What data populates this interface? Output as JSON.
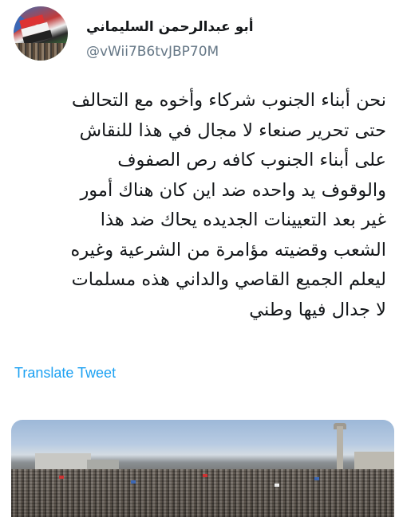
{
  "tweet": {
    "author": {
      "display_name": "أبو عبدالرحمن السليماني",
      "handle": "@vWii7B6tvJBP70M"
    },
    "text_lines": [
      "نحن أبناء الجنوب شركاء وأخوه مع التحالف",
      "حتى تحرير صنعاء لا مجال في هذا للنقاش",
      "على أبناء الجنوب كافه رص الصفوف",
      "والوقوف يد واحده ضد اين كان هناك أمور",
      "غير بعد التعيينات الجديده يحاك ضد هذا",
      "الشعب وقضيته مؤامرة من الشرعية وغيره",
      "ليعلم الجميع القاصي والداني هذه مسلمات",
      "لا جدال فيها وطني"
    ],
    "translate_label": "Translate Tweet",
    "media": {
      "kind": "photo"
    }
  },
  "colors": {
    "link": "#1da1f2",
    "text": "#14171a",
    "secondary": "#657786"
  }
}
